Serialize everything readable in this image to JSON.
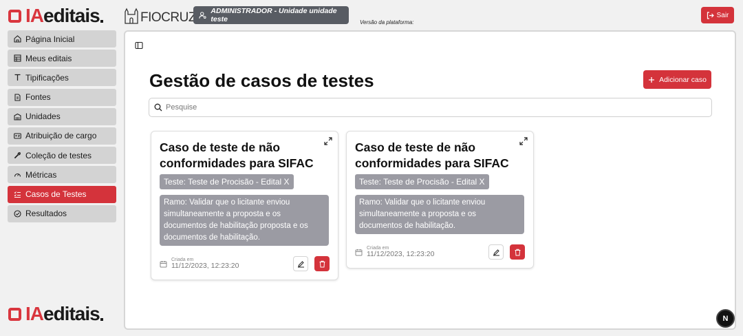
{
  "brand": {
    "prefix": "IA",
    "suffix": "editais"
  },
  "partner_logo": {
    "name": "FIOCRUZ"
  },
  "header": {
    "user_label": "ADMINISTRADOR - Unidade unidade teste",
    "version_label": "Versão da plataforma:",
    "logout_label": "Sair"
  },
  "sidebar": {
    "items": [
      {
        "label": "Página Inicial",
        "icon": "home-icon"
      },
      {
        "label": "Meus editais",
        "icon": "table-icon"
      },
      {
        "label": "Tipificações",
        "icon": "type-icon"
      },
      {
        "label": "Fontes",
        "icon": "document-icon"
      },
      {
        "label": "Unidades",
        "icon": "building-icon"
      },
      {
        "label": "Atribuição de cargo",
        "icon": "id-card-icon"
      },
      {
        "label": "Coleção de testes",
        "icon": "wrench-icon"
      },
      {
        "label": "Métricas",
        "icon": "gauge-icon"
      },
      {
        "label": "Casos de Testes",
        "icon": "list-check-icon",
        "active": true
      },
      {
        "label": "Resultados",
        "icon": "check-circle-icon"
      }
    ]
  },
  "main": {
    "title": "Gestão de casos de testes",
    "add_label": "Adicionar caso",
    "search_placeholder": "Pesquise"
  },
  "cards": [
    {
      "title": "Caso de teste de não conformidades para SIFAC",
      "test": "Teste: Teste de Procisão - Edital X",
      "branch": "Ramo: Validar que o licitante enviou simultaneamente a proposta e os documentos de habilitação proposta e os documentos de habilitação.",
      "created_label": "Criada em",
      "created_value": "11/12/2023, 12:23:20"
    },
    {
      "title": "Caso de teste de não conformidades para SIFAC",
      "test": "Teste: Teste de Procisão - Edital X",
      "branch": "Ramo: Validar que o licitante enviou simultaneamente a proposta e os documentos de habilitação.",
      "created_label": "Criada em",
      "created_value": "11/12/2023, 12:23:20"
    }
  ],
  "dev_badge": "N",
  "colors": {
    "accent": "#d4333b",
    "chip": "#9b9ba3",
    "nav": "#d3d3d3"
  }
}
